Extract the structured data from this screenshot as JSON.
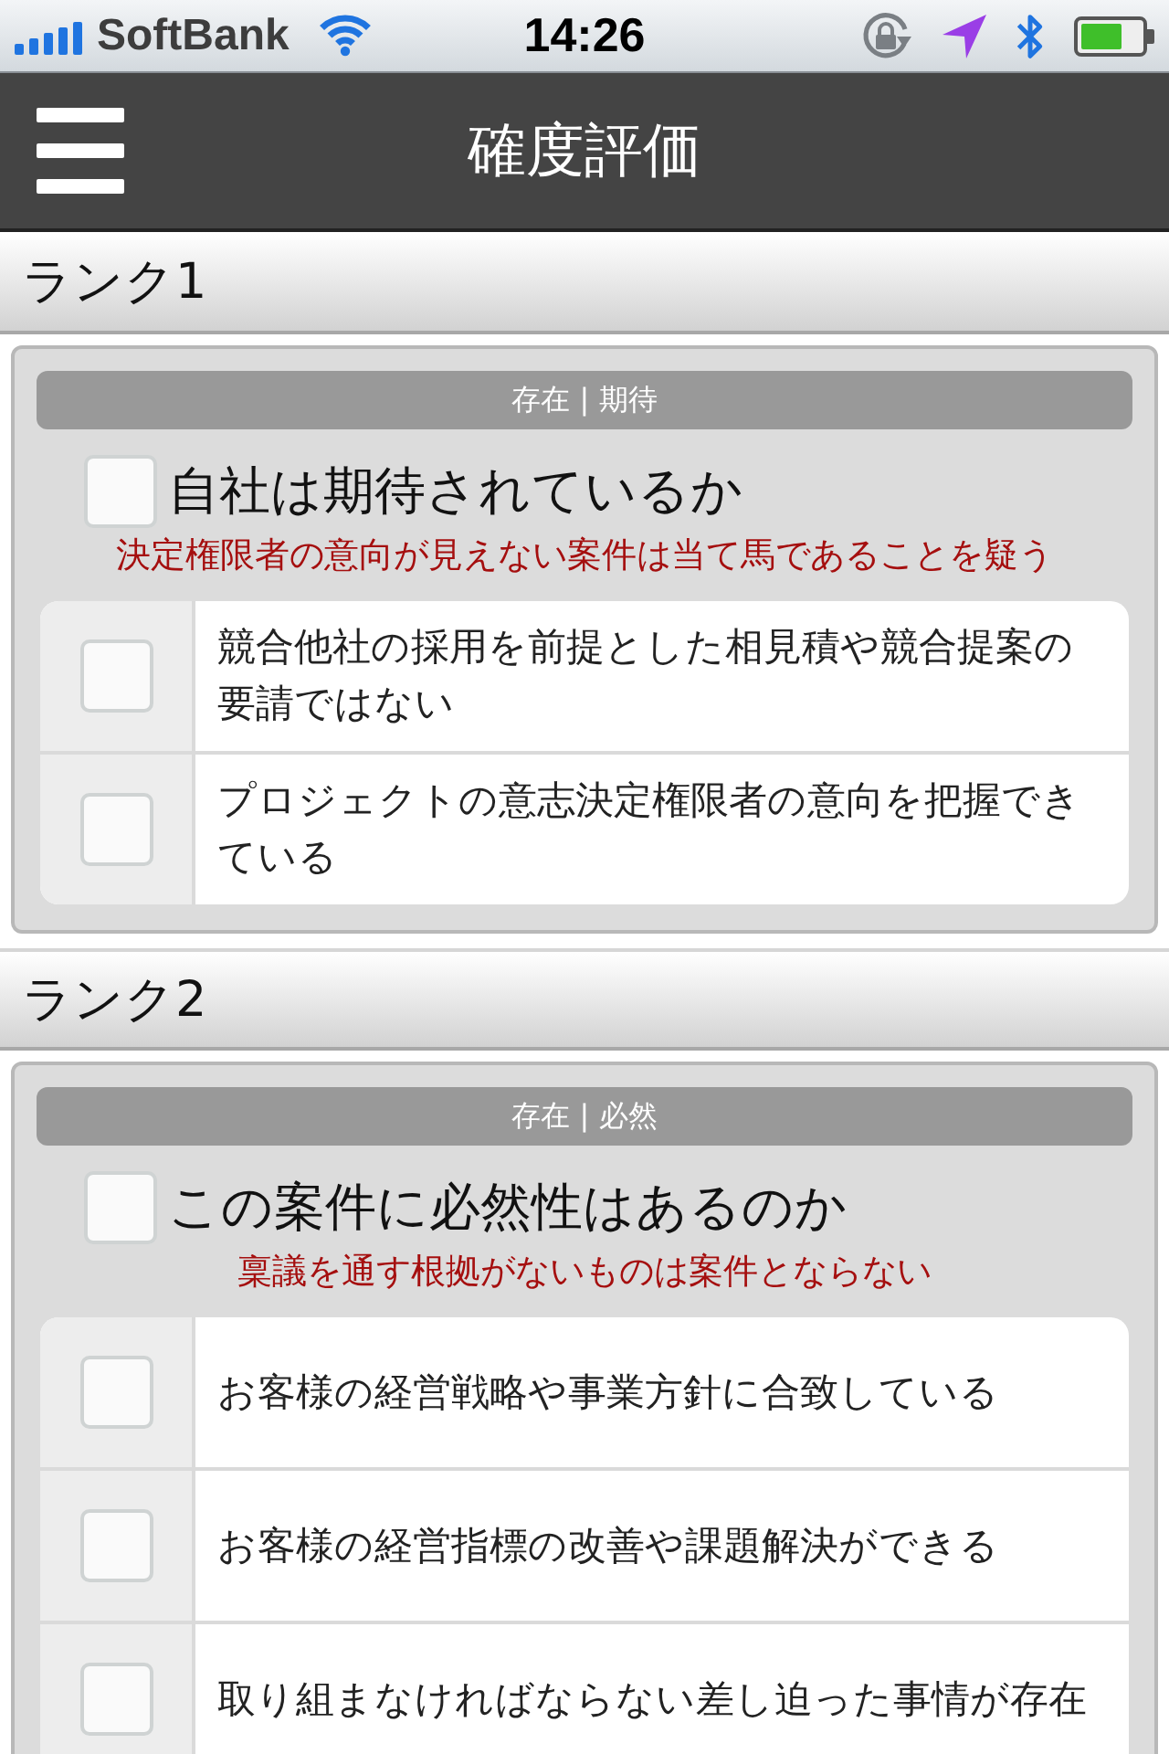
{
  "status_bar": {
    "carrier": "SoftBank",
    "time": "14:26"
  },
  "header": {
    "title": "確度評価"
  },
  "sections": [
    {
      "title": "ランク1",
      "category": "存在 | 期待",
      "question": {
        "text": "自社は期待されているか",
        "checked": false
      },
      "note": "決定権限者の意向が見えない案件は当て馬であることを疑う",
      "items": [
        {
          "text": "競合他社の採用を前提とした相見積や競合提案の要請ではない",
          "checked": false
        },
        {
          "text": "プロジェクトの意志決定権限者の意向を把握できている",
          "checked": false
        }
      ]
    },
    {
      "title": "ランク2",
      "category": "存在 | 必然",
      "question": {
        "text": "この案件に必然性はあるのか",
        "checked": false
      },
      "note": "稟議を通す根拠がないものは案件とならない",
      "items": [
        {
          "text": "お客様の経営戦略や事業方針に合致している",
          "checked": false
        },
        {
          "text": "お客様の経営指標の改善や課題解決ができる",
          "checked": false
        },
        {
          "text": "取り組まなければならない差し迫った事情が存在",
          "checked": false
        }
      ]
    }
  ]
}
